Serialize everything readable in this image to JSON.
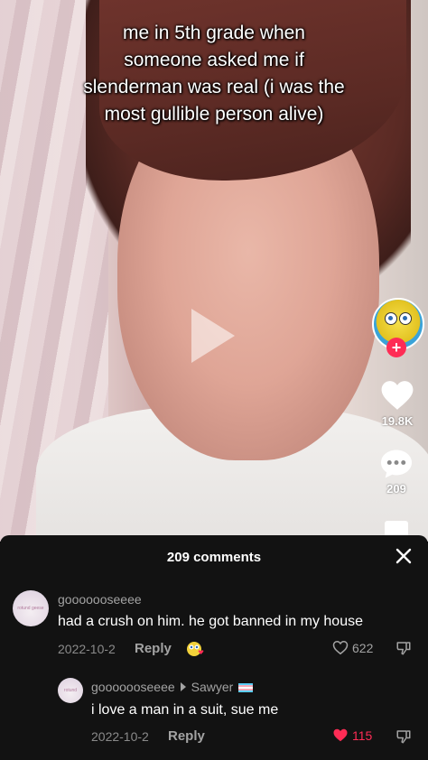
{
  "video": {
    "caption": "me in 5th grade when someone asked me if slenderman was real (i was the most gullible person alive)"
  },
  "sidebar": {
    "likes": "19.8K",
    "comments": "209"
  },
  "comments_sheet": {
    "title": "209 comments",
    "comments": [
      {
        "user": "gooooooseeee",
        "avatar_text": "rotund geese",
        "text": "had a crush on him. he got banned in my house",
        "date": "2022-10-2",
        "reply_label": "Reply",
        "likes": "622"
      },
      {
        "user": "gooooooseeee",
        "reply_to": "Sawyer",
        "avatar_text": "rotund geese",
        "text": "i love a man in a suit, sue me",
        "date": "2022-10-2",
        "reply_label": "Reply",
        "likes": "115"
      }
    ]
  },
  "colors": {
    "accent": "#fe2c55",
    "sheet_bg": "#121212"
  },
  "icons": [
    "play-icon",
    "heart-icon",
    "comment-icon",
    "close-icon",
    "dislike-icon",
    "flag-icon"
  ]
}
